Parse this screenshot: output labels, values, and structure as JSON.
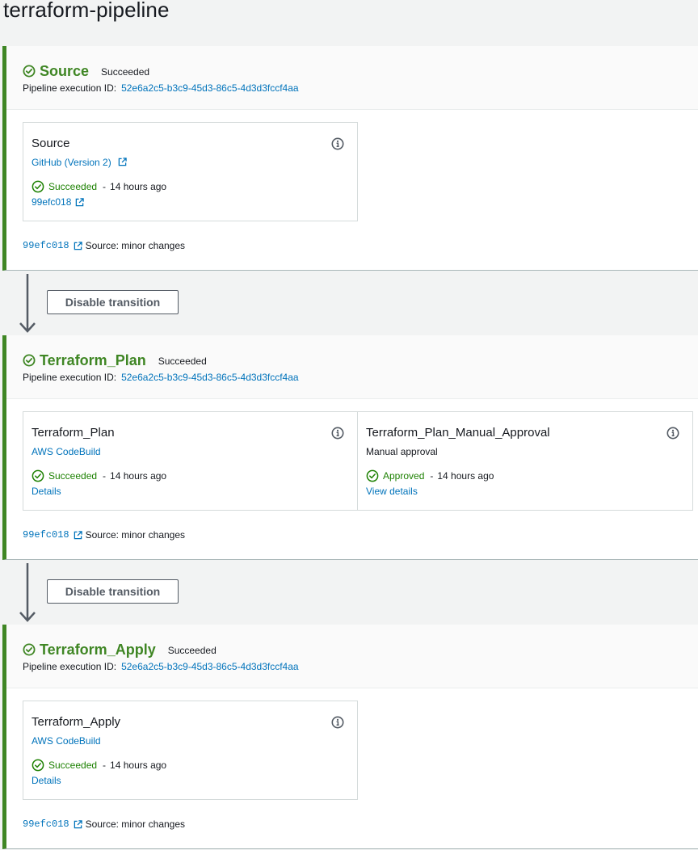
{
  "page": {
    "title": "terraform-pipeline"
  },
  "colors": {
    "success": "#3f8624",
    "link": "#0073bb",
    "status_green": "#1d8102"
  },
  "transition_button_label": "Disable transition",
  "stages": [
    {
      "name": "Source",
      "status": "Succeeded",
      "exec_label": "Pipeline execution ID:",
      "exec_id": "52e6a2c5-b3c9-45d3-86c5-4d3d3fccf4aa",
      "actions": [
        {
          "name": "Source",
          "provider": "GitHub (Version 2)",
          "status": "Succeeded",
          "time": "14 hours ago",
          "link": "99efc018"
        }
      ],
      "commit": {
        "id": "99efc018",
        "message": "Source: minor changes"
      }
    },
    {
      "name": "Terraform_Plan",
      "status": "Succeeded",
      "exec_label": "Pipeline execution ID:",
      "exec_id": "52e6a2c5-b3c9-45d3-86c5-4d3d3fccf4aa",
      "actions": [
        {
          "name": "Terraform_Plan",
          "provider": "AWS CodeBuild",
          "status": "Succeeded",
          "time": "14 hours ago",
          "link": "Details"
        },
        {
          "name": "Terraform_Plan_Manual_Approval",
          "provider": "Manual approval",
          "status": "Approved",
          "time": "14 hours ago",
          "link": "View details"
        }
      ],
      "commit": {
        "id": "99efc018",
        "message": "Source: minor changes"
      }
    },
    {
      "name": "Terraform_Apply",
      "status": "Succeeded",
      "exec_label": "Pipeline execution ID:",
      "exec_id": "52e6a2c5-b3c9-45d3-86c5-4d3d3fccf4aa",
      "actions": [
        {
          "name": "Terraform_Apply",
          "provider": "AWS CodeBuild",
          "status": "Succeeded",
          "time": "14 hours ago",
          "link": "Details"
        }
      ],
      "commit": {
        "id": "99efc018",
        "message": "Source: minor changes"
      }
    }
  ]
}
